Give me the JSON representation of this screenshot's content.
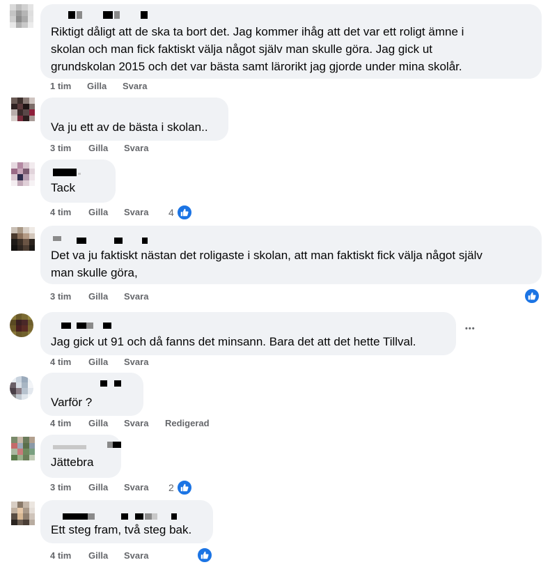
{
  "comments": [
    {
      "text": "Riktigt dåligt att de ska ta bort det. Jag kommer ihåg att det var ett roligt ämne i\nskolan och man fick faktiskt välja något själv man skulle göra. Jag gick ut\ngrundskolan 2015 och det var bästa samt lärorikt jag gjorde under mina skolår.",
      "time": "1 tim",
      "like": "Gilla",
      "reply": "Svara"
    },
    {
      "text": "Va ju ett av de bästa i skolan..",
      "time": "3 tim",
      "like": "Gilla",
      "reply": "Svara"
    },
    {
      "text": "Tack",
      "time": "4 tim",
      "like": "Gilla",
      "reply": "Svara",
      "reactions": "4"
    },
    {
      "text": "Det va ju faktiskt nästan det roligaste i skolan, att man faktiskt fick välja något själv\nman skulle göra,",
      "time": "3 tim",
      "like": "Gilla",
      "reply": "Svara"
    },
    {
      "text": "Jag gick ut 91 och då fanns det minsann. Bara det att det hette Tillval.",
      "time": "4 tim",
      "like": "Gilla",
      "reply": "Svara",
      "more": "•••"
    },
    {
      "text": "Varför ?",
      "time": "4 tim",
      "like": "Gilla",
      "reply": "Svara",
      "edited": "Redigerad"
    },
    {
      "text": "Jättebra",
      "time": "3 tim",
      "like": "Gilla",
      "reply": "Svara",
      "reactions": "2"
    },
    {
      "text": "Ett steg fram, två steg bak.",
      "time": "4 tim",
      "like": "Gilla",
      "reply": "Svara"
    }
  ],
  "colors": {
    "bubble": "#f0f2f5",
    "like_blue": "#1b74e4",
    "meta_gray": "#65676b"
  },
  "icons": {
    "reaction": "thumbs-up-icon",
    "menu": "more-options-icon"
  }
}
